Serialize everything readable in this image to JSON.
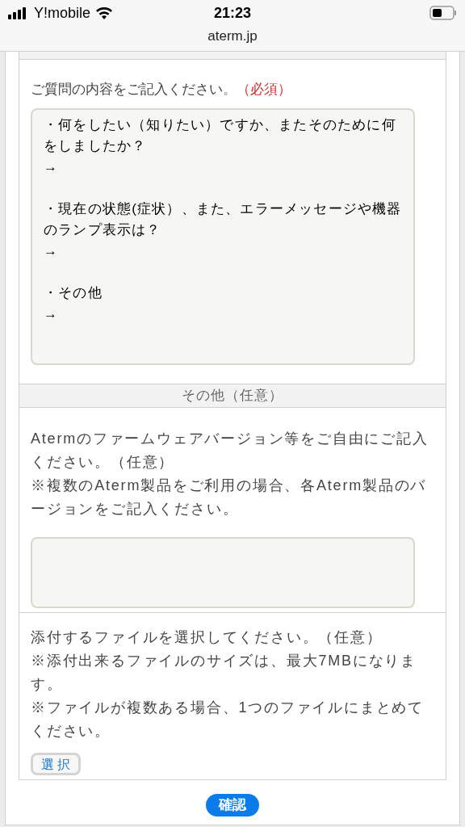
{
  "status_bar": {
    "carrier": "Y!mobile",
    "time": "21:23",
    "url": "aterm.jp"
  },
  "question": {
    "label": "ご質問の内容をご記入ください。",
    "required": "（必須）",
    "value": "・何をしたい（知りたい）ですか、またそのために何をしましたか？\n→\n\n・現在の状態(症状）、また、エラーメッセージや機器のランプ表示は？\n→\n\n・その他\n→"
  },
  "other_section": {
    "header": "その他（任意）",
    "description": [
      "Atermのファームウェアバージョン等をご自由にご記入ください。（任意）",
      "※複数のAterm製品をご利用の場合、各Aterm製品のバージョンをご記入ください。"
    ]
  },
  "attachment": {
    "description": [
      "添付するファイルを選択してください。（任意）",
      "※添付出来るファイルのサイズは、最大7MBになります。",
      "※ファイルが複数ある場合、1つのファイルにまとめてください。"
    ],
    "select_button": "選 択"
  },
  "confirm_button": "確認"
}
